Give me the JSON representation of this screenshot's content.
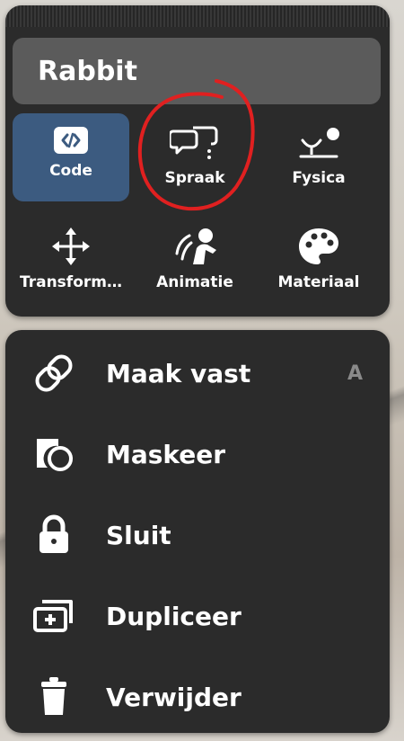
{
  "panel": {
    "object_name": "Rabbit",
    "tiles": [
      {
        "label": "Code",
        "icon": "code-icon",
        "active": true
      },
      {
        "label": "Spraak",
        "icon": "speech-bubbles-icon",
        "active": false
      },
      {
        "label": "Fysica",
        "icon": "physics-icon",
        "active": false
      },
      {
        "label": "Transform…",
        "icon": "move-arrows-icon",
        "active": false
      },
      {
        "label": "Animatie",
        "icon": "animation-icon",
        "active": false
      },
      {
        "label": "Materiaal",
        "icon": "palette-icon",
        "active": false
      }
    ]
  },
  "menu": {
    "items": [
      {
        "label": "Maak vast",
        "icon": "link-icon",
        "shortcut": "A"
      },
      {
        "label": "Maskeer",
        "icon": "mask-icon"
      },
      {
        "label": "Sluit",
        "icon": "lock-icon"
      },
      {
        "label": "Dupliceer",
        "icon": "duplicate-icon"
      },
      {
        "label": "Verwijder",
        "icon": "trash-icon"
      }
    ]
  },
  "colors": {
    "panel_bg": "#2b2b2b",
    "title_bg": "#5b5b5b",
    "active_tile_bg": "#3c5b80",
    "annotation_red": "#e02020",
    "shortcut_gray": "#8a8a8a"
  }
}
